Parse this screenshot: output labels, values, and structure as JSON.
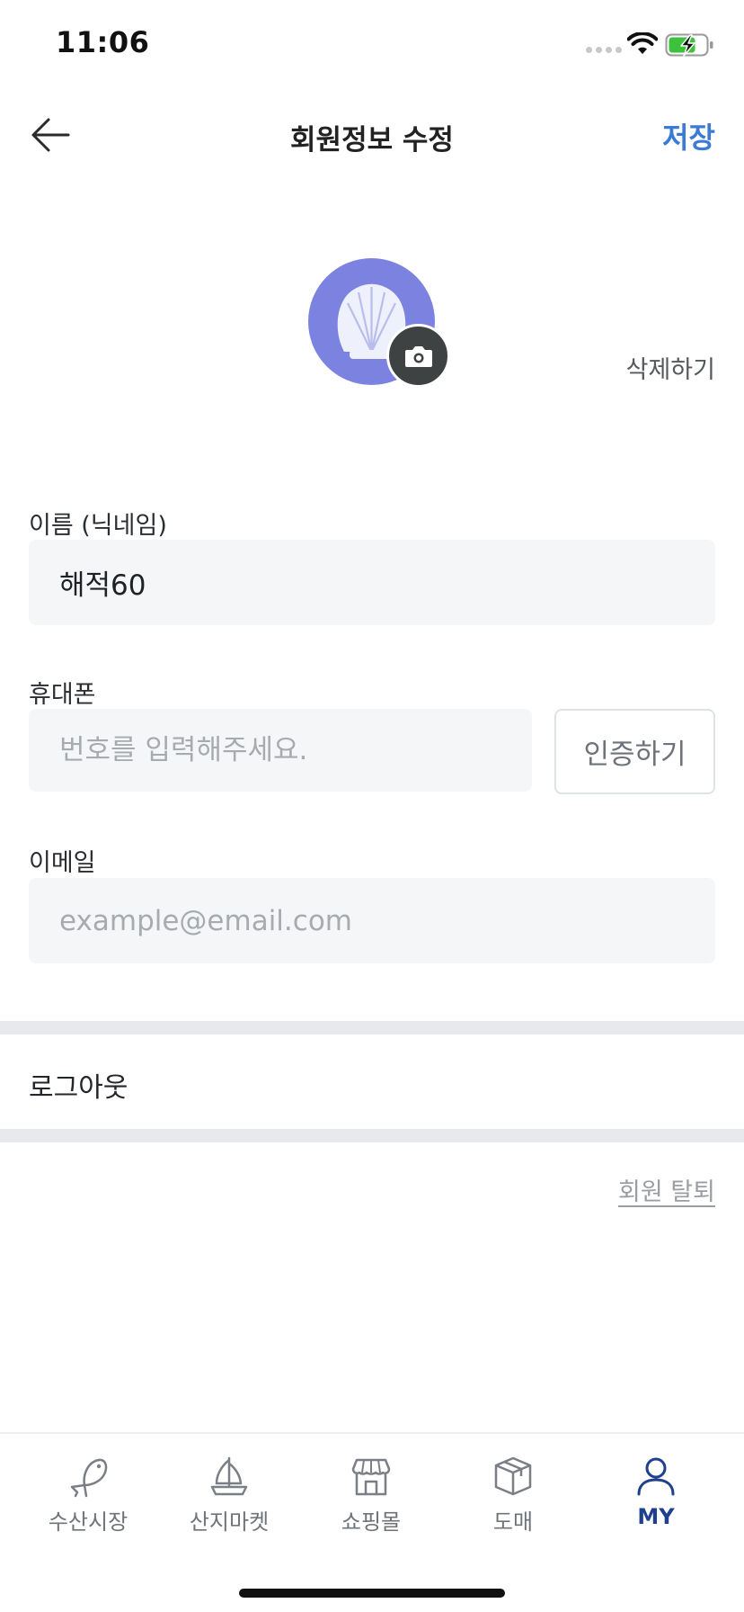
{
  "status_bar": {
    "time": "11:06",
    "icons": [
      "signal-dots-icon",
      "wifi-icon",
      "battery-charging-icon"
    ],
    "battery_color": "#3ec23e"
  },
  "header": {
    "title": "회원정보 수정",
    "save_label": "저장",
    "back_icon": "arrow-left-icon"
  },
  "profile": {
    "avatar_icon": "shell-icon",
    "avatar_bg": "#7b82e0",
    "camera_icon": "camera-icon",
    "delete_label": "삭제하기"
  },
  "form": {
    "name": {
      "label": "이름 (닉네임)",
      "value": "해적60",
      "placeholder": ""
    },
    "phone": {
      "label": "휴대폰",
      "value": "",
      "placeholder": "번호를 입력해주세요.",
      "verify_label": "인증하기"
    },
    "email": {
      "label": "이메일",
      "value": "",
      "placeholder": "example@email.com"
    }
  },
  "logout_label": "로그아웃",
  "withdraw_label": "회원 탈퇴",
  "colors": {
    "accent": "#3a7bd5",
    "active_tab": "#1f3f8f",
    "inactive_tab": "#6f7479",
    "input_bg": "#f5f6f8"
  },
  "tab_bar": {
    "items": [
      {
        "label": "수산시장",
        "icon": "fish-icon",
        "active": false
      },
      {
        "label": "산지마켓",
        "icon": "sailboat-icon",
        "active": false
      },
      {
        "label": "쇼핑몰",
        "icon": "storefront-icon",
        "active": false
      },
      {
        "label": "도매",
        "icon": "box-icon",
        "active": false
      },
      {
        "label": "MY",
        "icon": "user-icon",
        "active": true
      }
    ]
  }
}
